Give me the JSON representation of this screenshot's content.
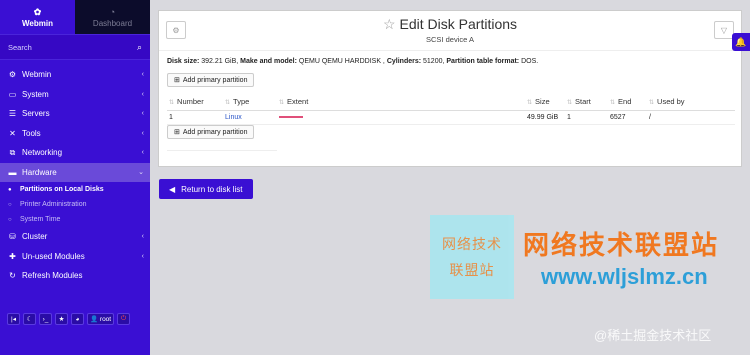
{
  "sidebar": {
    "tab_webmin": "Webmin",
    "tab_dashboard": "Dashboard",
    "search_placeholder": "Search",
    "menu": [
      {
        "label": "Webmin"
      },
      {
        "label": "System"
      },
      {
        "label": "Servers"
      },
      {
        "label": "Tools"
      },
      {
        "label": "Networking"
      },
      {
        "label": "Hardware"
      },
      {
        "label": "Cluster"
      },
      {
        "label": "Un-used Modules"
      },
      {
        "label": "Refresh Modules"
      }
    ],
    "hardware_sub": [
      {
        "label": "Partitions on Local Disks"
      },
      {
        "label": "Printer Administration"
      },
      {
        "label": "System Time"
      }
    ],
    "bottom_user": "root"
  },
  "header": {
    "title": "Edit Disk Partitions",
    "subtitle": "SCSI device A"
  },
  "info": {
    "disk_size_label": "Disk size:",
    "disk_size": "392.21 GiB,",
    "model_label": "Make and model:",
    "model": "QEMU QEMU HARDDISK ,",
    "cylinders_label": "Cylinders:",
    "cylinders": "51200,",
    "format_label": "Partition table format:",
    "format": "DOS."
  },
  "buttons": {
    "add_primary": "Add primary partition",
    "return": "Return to disk list"
  },
  "table": {
    "columns": [
      "Number",
      "Type",
      "Extent",
      "Size",
      "Start",
      "End",
      "Used by"
    ],
    "rows": [
      {
        "number": "1",
        "type": "Linux",
        "size": "49.99 GiB",
        "start": "1",
        "end": "6527",
        "used_by": "/"
      }
    ]
  },
  "watermark": {
    "logo_line1": "网络技术",
    "logo_line2": "联盟站",
    "title": "网络技术联盟站",
    "url": "www.wljslmz.cn",
    "credit": "@稀土掘金技术社区"
  },
  "colors": {
    "sidebar": "#3a0fd3",
    "accent": "#3a0fd3",
    "extent_bar": "#e0507a"
  }
}
